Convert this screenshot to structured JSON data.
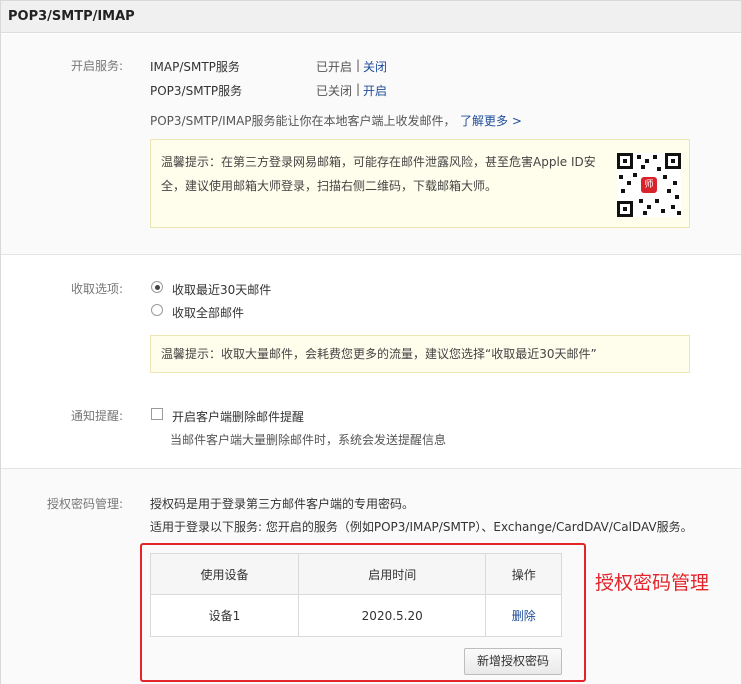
{
  "title": "POP3/SMTP/IMAP",
  "services": {
    "label": "开启服务:",
    "rows": [
      {
        "name": "IMAP/SMTP服务",
        "status": "已开启",
        "sep": "|",
        "action": "关闭"
      },
      {
        "name": "POP3/SMTP服务",
        "status": "已关闭",
        "sep": "|",
        "action": "开启"
      }
    ],
    "description": "POP3/SMTP/IMAP服务能让你在本地客户端上收发邮件，",
    "learn_more": "了解更多 >",
    "tip_line1": "温馨提示：在第三方登录网易邮箱，可能存在邮件泄露风险，甚至危害Apple ID安",
    "tip_line2": "全，建议使用邮箱大师登录，扫描右侧二维码，下载邮箱大师。",
    "qr_icon": "qr-code-icon",
    "qr_logo": "师"
  },
  "receive": {
    "label": "收取选项:",
    "options": [
      {
        "label": "收取最近30天邮件",
        "selected": true
      },
      {
        "label": "收取全部邮件",
        "selected": false
      }
    ],
    "tip": "温馨提示：收取大量邮件，会耗费您更多的流量，建议您选择“收取最近30天邮件”"
  },
  "notify": {
    "label": "通知提醒:",
    "checkbox_label": "开启客户端删除邮件提醒",
    "checked": false,
    "desc": "当邮件客户端大量删除邮件时，系统会发送提醒信息"
  },
  "auth": {
    "label": "授权密码管理:",
    "desc1": "授权码是用于登录第三方邮件客户端的专用密码。",
    "desc2": "适用于登录以下服务: 您开启的服务（例如POP3/IMAP/SMTP）、Exchange/CardDAV/CalDAV服务。",
    "table": {
      "headers": [
        "使用设备",
        "启用时间",
        "操作"
      ],
      "rows": [
        {
          "device": "设备1",
          "time": "2020.5.20",
          "action": "删除"
        }
      ]
    },
    "add_button": "新增授权密码"
  },
  "annotation": "授权密码管理",
  "colors": {
    "link": "#1f4c9b",
    "annotation": "#e3242b",
    "tip_bg": "#fffdec"
  }
}
